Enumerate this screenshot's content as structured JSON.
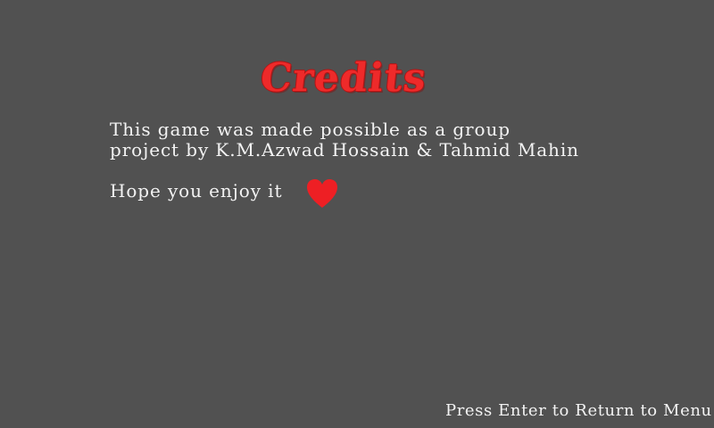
{
  "screen": {
    "background_color": "#515151",
    "accent_color": "#ee2a2a"
  },
  "credits": {
    "title": "Credits",
    "line1": "This game was made possible as a group",
    "line2": "project by K.M.Azwad Hossain & Tahmid Mahin",
    "line3": "Hope you enjoy it",
    "heart_icon": "heart-icon"
  },
  "footer": {
    "prompt": "Press Enter to Return to Menu"
  }
}
